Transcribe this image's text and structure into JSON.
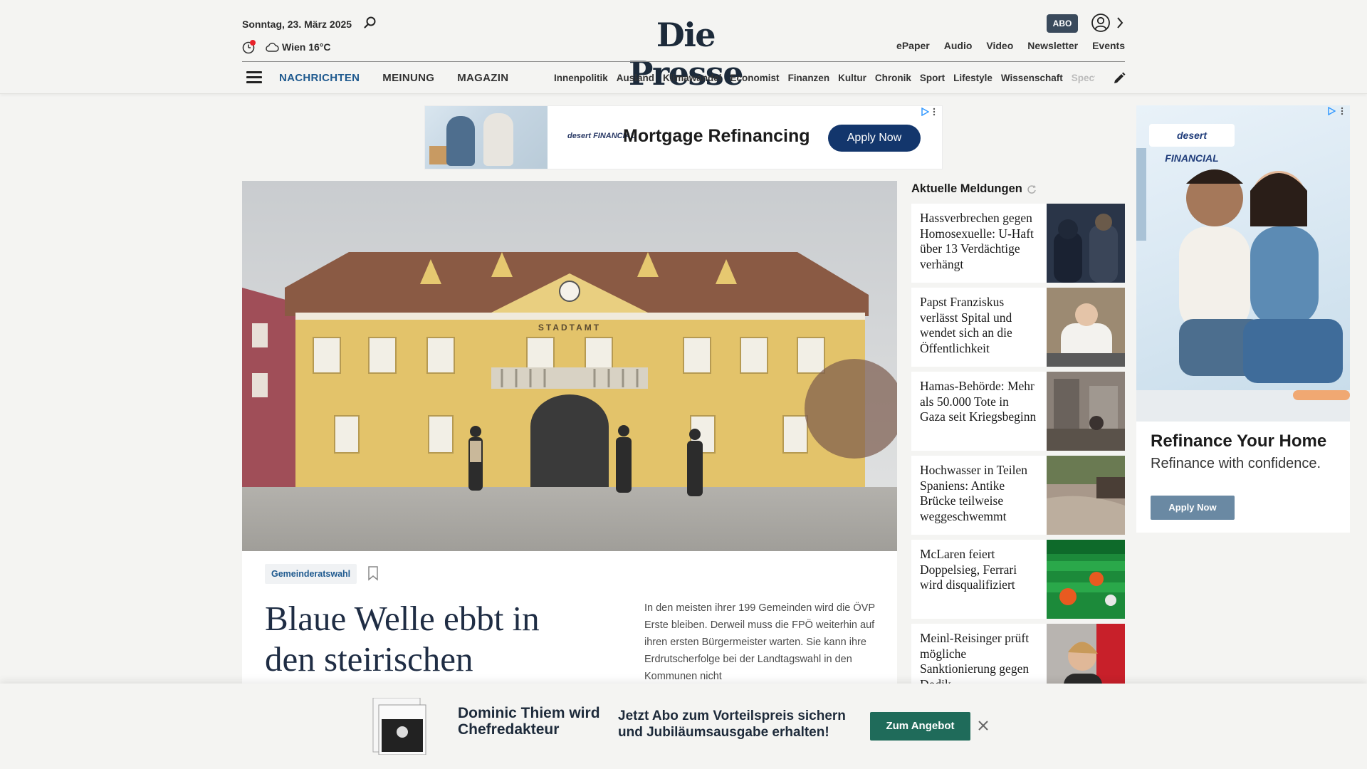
{
  "header": {
    "date": "Sonntag, 23. März 2025",
    "weather": "Wien 16°C",
    "logo": "Die Presse",
    "abo_label": "ABO",
    "top_links": [
      "ePaper",
      "Audio",
      "Video",
      "Newsletter",
      "Events"
    ],
    "main_nav": [
      "NACHRICHTEN",
      "MEINUNG",
      "MAGAZIN"
    ],
    "sub_nav": [
      "Innenpolitik",
      "Ausland",
      "Klimawandel",
      "Economist",
      "Finanzen",
      "Kultur",
      "Chronik",
      "Sport",
      "Lifestyle",
      "Wissenschaft",
      "Spectr"
    ]
  },
  "top_ad": {
    "brand": "desert FINANCIAL",
    "title": "Mortgage Refinancing",
    "button": "Apply Now"
  },
  "hero": {
    "sign": "STADTAMT",
    "tag": "Gemeinderatswahl",
    "headline": "Blaue Welle ebbt in den steirischen",
    "teaser": "In den meisten ihrer 199 Gemeinden wird die ÖVP Erste bleiben. Derweil muss die FPÖ weiterhin auf ihren ersten Bürgermeister warten. Sie kann ihre Erdrutscherfolge bei der Landtagswahl in den Kommunen nicht"
  },
  "sidebar": {
    "title": "Aktuelle Meldungen",
    "items": [
      {
        "title": "Hassverbrechen gegen Homosexuelle: U-Haft über 13 Verdächtige verhängt"
      },
      {
        "title": "Papst Franziskus verlässt Spital und wendet sich an die Öffentlichkeit"
      },
      {
        "title": "Hamas-Behörde: Mehr als 50.000 Tote in Gaza seit Kriegsbeginn"
      },
      {
        "title": "Hochwasser in Teilen Spaniens: Antike Brücke teilweise weggeschwemmt"
      },
      {
        "title": "McLaren feiert Doppelsieg, Ferrari wird disqualifiziert"
      },
      {
        "title": "Meinl-Reisinger prüft mögliche Sanktionierung gegen Dodik"
      }
    ]
  },
  "right_ad": {
    "brand": "desert FINANCIAL",
    "title": "Refinance Your Home",
    "subtitle": "Refinance with confidence.",
    "button": "Apply Now"
  },
  "promo": {
    "name": "Dominic Thiem wird Chefredakteur",
    "text": "Jetzt Abo zum Vorteilspreis sichern und Jubiläumsausgabe erhalten!",
    "button": "Zum Angebot"
  }
}
